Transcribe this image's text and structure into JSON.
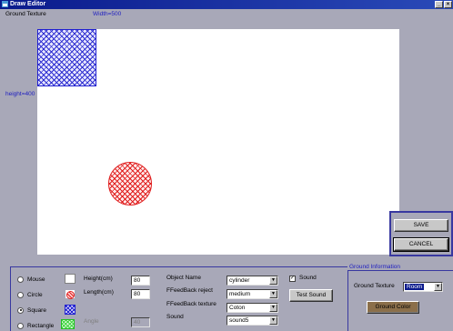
{
  "window": {
    "title": "Draw Editor",
    "minimize_glyph": "_",
    "close_glyph": "×"
  },
  "header": {
    "ground_texture_label": "Ground Texture",
    "width_label": "Width=500",
    "height_label": "height=400"
  },
  "canvas": {
    "shapes": [
      {
        "type": "square",
        "color": "#2020d0"
      },
      {
        "type": "circle",
        "color": "#e02020"
      }
    ]
  },
  "actions": {
    "save_label": "SAVE",
    "cancel_label": "CANCEL"
  },
  "shape_tools": {
    "items": [
      {
        "label": "Mouse",
        "checked": false
      },
      {
        "label": "Circle",
        "checked": false
      },
      {
        "label": "Square",
        "checked": true
      },
      {
        "label": "Rectangle",
        "checked": false
      }
    ]
  },
  "dimensions": {
    "height_label": "Height(cm)",
    "height_value": "80",
    "length_label": "Length(cm)",
    "length_value": "80",
    "angle_label": "Angle",
    "angle_value": "40"
  },
  "object": {
    "name_label": "Object Name",
    "name_value": "cylinder",
    "reject_label": "FFeedBack reject",
    "reject_value": "medium",
    "texture_label": "FFeedBack texture",
    "texture_value": "Coton",
    "sound_label": "Sound",
    "sound_value": "sound5"
  },
  "sound": {
    "checkbox_label": "Sound",
    "checked": true,
    "check_glyph": "✓",
    "test_button_label": "Test Sound"
  },
  "ground_info": {
    "title": "Ground Information",
    "texture_label": "Ground Texture",
    "texture_value": "Room",
    "color_button_label": "Ground Color"
  },
  "icons": {
    "combo_arrow": "▼"
  },
  "colors": {
    "title_bar": "#0a1a8c",
    "panel_bg": "#a8a8b8",
    "accent_blue": "#2020c0",
    "ground_color": "#8b6f4a"
  }
}
